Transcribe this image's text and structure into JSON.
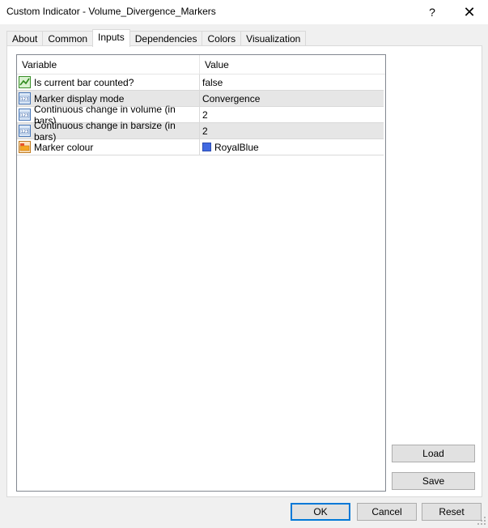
{
  "window": {
    "title": "Custom Indicator - Volume_Divergence_Markers",
    "help_glyph": "?",
    "close_glyph": "✕"
  },
  "tabs": [
    {
      "label": "About"
    },
    {
      "label": "Common"
    },
    {
      "label": "Inputs"
    },
    {
      "label": "Dependencies"
    },
    {
      "label": "Colors"
    },
    {
      "label": "Visualization"
    }
  ],
  "active_tab": "Inputs",
  "grid": {
    "headers": {
      "variable": "Variable",
      "value": "Value"
    },
    "rows": [
      {
        "variable": "Is current bar counted?",
        "value": "false",
        "icon": "boolean-icon"
      },
      {
        "variable": "Marker display mode",
        "value": "Convergence",
        "icon": "numeric-icon"
      },
      {
        "variable": "Continuous change in volume (in bars)",
        "value": "2",
        "icon": "numeric-icon"
      },
      {
        "variable": "Continuous change in barsize (in bars)",
        "value": "2",
        "icon": "numeric-icon"
      },
      {
        "variable": "Marker colour",
        "value": "RoyalBlue",
        "icon": "color-icon",
        "swatch": "#4169E1"
      }
    ]
  },
  "buttons": {
    "load": "Load",
    "save": "Save",
    "ok": "OK",
    "cancel": "Cancel",
    "reset": "Reset"
  },
  "colors": {
    "accent": "#0078d7",
    "swatch_royalblue": "#4169E1"
  }
}
